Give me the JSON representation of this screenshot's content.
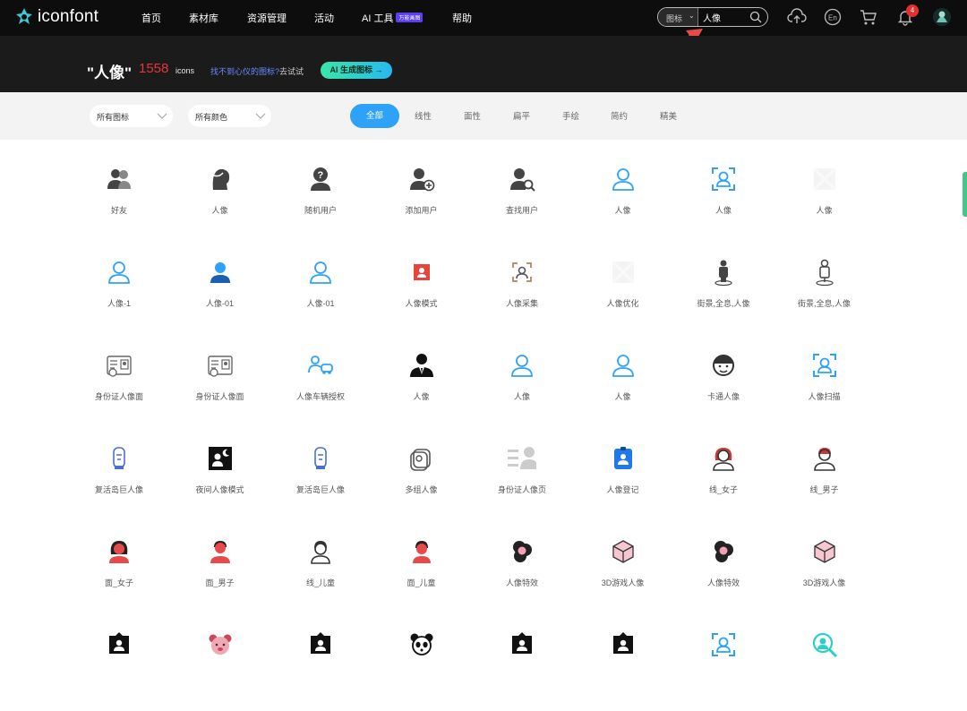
{
  "brand": {
    "name": "iconfont"
  },
  "nav": {
    "items": [
      {
        "label": "首页"
      },
      {
        "label": "素材库"
      },
      {
        "label": "资源管理"
      },
      {
        "label": "活动"
      },
      {
        "label": "AI 工具"
      },
      {
        "label": "帮助"
      }
    ],
    "ai_badge": "万能画图"
  },
  "search": {
    "type_label": "图标",
    "value": "人像"
  },
  "notifications": {
    "count": "4"
  },
  "result": {
    "query": "\"人像\"",
    "count": "1558",
    "count_unit": "icons",
    "hint_link": "找不到心仪的图标?",
    "hint_text": "去试试",
    "ai_button": "AI 生成图标 →"
  },
  "filters": {
    "icon_type": "所有图标",
    "color": "所有颜色",
    "tabs": [
      "全部",
      "线性",
      "面性",
      "扁平",
      "手绘",
      "简约",
      "精美"
    ],
    "active_tab": "全部"
  },
  "icons": [
    {
      "name": "好友",
      "icon": "friends-icon"
    },
    {
      "name": "人像",
      "icon": "head-profile-icon"
    },
    {
      "name": "随机用户",
      "icon": "random-user-icon"
    },
    {
      "name": "添加用户",
      "icon": "add-user-icon"
    },
    {
      "name": "查找用户",
      "icon": "find-user-icon"
    },
    {
      "name": "人像",
      "icon": "user-outline-icon"
    },
    {
      "name": "人像",
      "icon": "face-scan-icon"
    },
    {
      "name": "人像",
      "icon": "blank-icon"
    },
    {
      "name": "人像-1",
      "icon": "user-outline-icon"
    },
    {
      "name": "人像-01",
      "icon": "user-filled-icon"
    },
    {
      "name": "人像-01",
      "icon": "user-outline-icon"
    },
    {
      "name": "人像模式",
      "icon": "portrait-mode-icon"
    },
    {
      "name": "人像采集",
      "icon": "portrait-capture-icon"
    },
    {
      "name": "人像优化",
      "icon": "blank-icon"
    },
    {
      "name": "街景,全息,人像",
      "icon": "hologram-person-icon"
    },
    {
      "name": "街景,全息,人像",
      "icon": "hologram-person-outline-icon"
    },
    {
      "name": "身份证人像面",
      "icon": "id-card-icon"
    },
    {
      "name": "身份证人像面",
      "icon": "id-card-icon"
    },
    {
      "name": "人像车辆授权",
      "icon": "person-car-icon"
    },
    {
      "name": "人像",
      "icon": "suit-person-icon"
    },
    {
      "name": "人像",
      "icon": "user-outline-icon"
    },
    {
      "name": "人像",
      "icon": "user-outline-icon"
    },
    {
      "name": "卡通人像",
      "icon": "cartoon-face-icon"
    },
    {
      "name": "人像扫描",
      "icon": "face-scan-icon"
    },
    {
      "name": "复活岛巨人像",
      "icon": "moai-icon"
    },
    {
      "name": "夜间人像模式",
      "icon": "night-portrait-icon"
    },
    {
      "name": "复活岛巨人像",
      "icon": "moai-icon"
    },
    {
      "name": "多组人像",
      "icon": "multi-portrait-icon"
    },
    {
      "name": "身份证人像页",
      "icon": "id-page-icon"
    },
    {
      "name": "人像登记",
      "icon": "register-badge-icon"
    },
    {
      "name": "线_女子",
      "icon": "woman-line-icon"
    },
    {
      "name": "线_男子",
      "icon": "man-line-icon"
    },
    {
      "name": "面_女子",
      "icon": "woman-filled-icon"
    },
    {
      "name": "面_男子",
      "icon": "man-filled-icon"
    },
    {
      "name": "线_儿童",
      "icon": "child-line-icon"
    },
    {
      "name": "面_儿童",
      "icon": "child-filled-icon"
    },
    {
      "name": "人像特效",
      "icon": "curly-hair-icon"
    },
    {
      "name": "3D游戏人像",
      "icon": "cube-icon"
    },
    {
      "name": "人像特效",
      "icon": "curly-hair-icon"
    },
    {
      "name": "3D游戏人像",
      "icon": "cube-icon"
    },
    {
      "name": "",
      "icon": "portrait-frame-icon"
    },
    {
      "name": "",
      "icon": "bear-icon"
    },
    {
      "name": "",
      "icon": "portrait-frame-icon"
    },
    {
      "name": "",
      "icon": "panda-icon"
    },
    {
      "name": "",
      "icon": "portrait-frame-icon"
    },
    {
      "name": "",
      "icon": "portrait-frame-icon"
    },
    {
      "name": "",
      "icon": "face-scan-icon"
    },
    {
      "name": "",
      "icon": "search-person-icon"
    }
  ],
  "colors": {
    "topbar": "#0d0d0d",
    "accent": "#2ea2f8",
    "count": "#e8343c",
    "arrow": "#e84a4a"
  }
}
